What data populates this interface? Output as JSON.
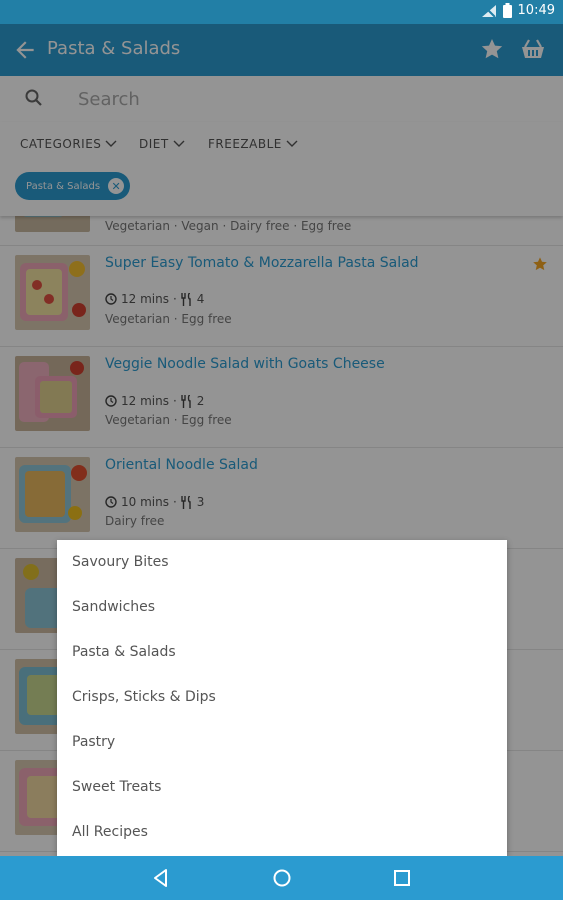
{
  "status": {
    "time": "10:49"
  },
  "appbar": {
    "title": "Pasta & Salads"
  },
  "search": {
    "placeholder": "Search"
  },
  "filters": {
    "categories": "CATEGORIES",
    "diet": "DIET",
    "freezable": "FREEZABLE",
    "chip": "Pasta & Salads"
  },
  "recipes": [
    {
      "title": "",
      "time": "",
      "serves": "",
      "tags": "Vegetarian · Vegan · Dairy free · Egg free"
    },
    {
      "title": "Super Easy Tomato & Mozzarella Pasta Salad",
      "time": "12 mins",
      "serves": "4",
      "tags": "Vegetarian · Egg free",
      "starred": true
    },
    {
      "title": "Veggie Noodle Salad with Goats Cheese",
      "time": "12 mins",
      "serves": "2",
      "tags": "Vegetarian · Egg free"
    },
    {
      "title": "Oriental Noodle Salad",
      "time": "10 mins",
      "serves": "3",
      "tags": "Dairy free"
    }
  ],
  "menu": {
    "items": [
      "Savoury Bites",
      "Sandwiches",
      "Pasta & Salads",
      "Crisps, Sticks & Dips",
      "Pastry",
      "Sweet Treats",
      "All Recipes"
    ]
  },
  "colors": {
    "primary": "#2b9bd0",
    "statusbar": "#227fa6",
    "star": "#f5a623"
  }
}
